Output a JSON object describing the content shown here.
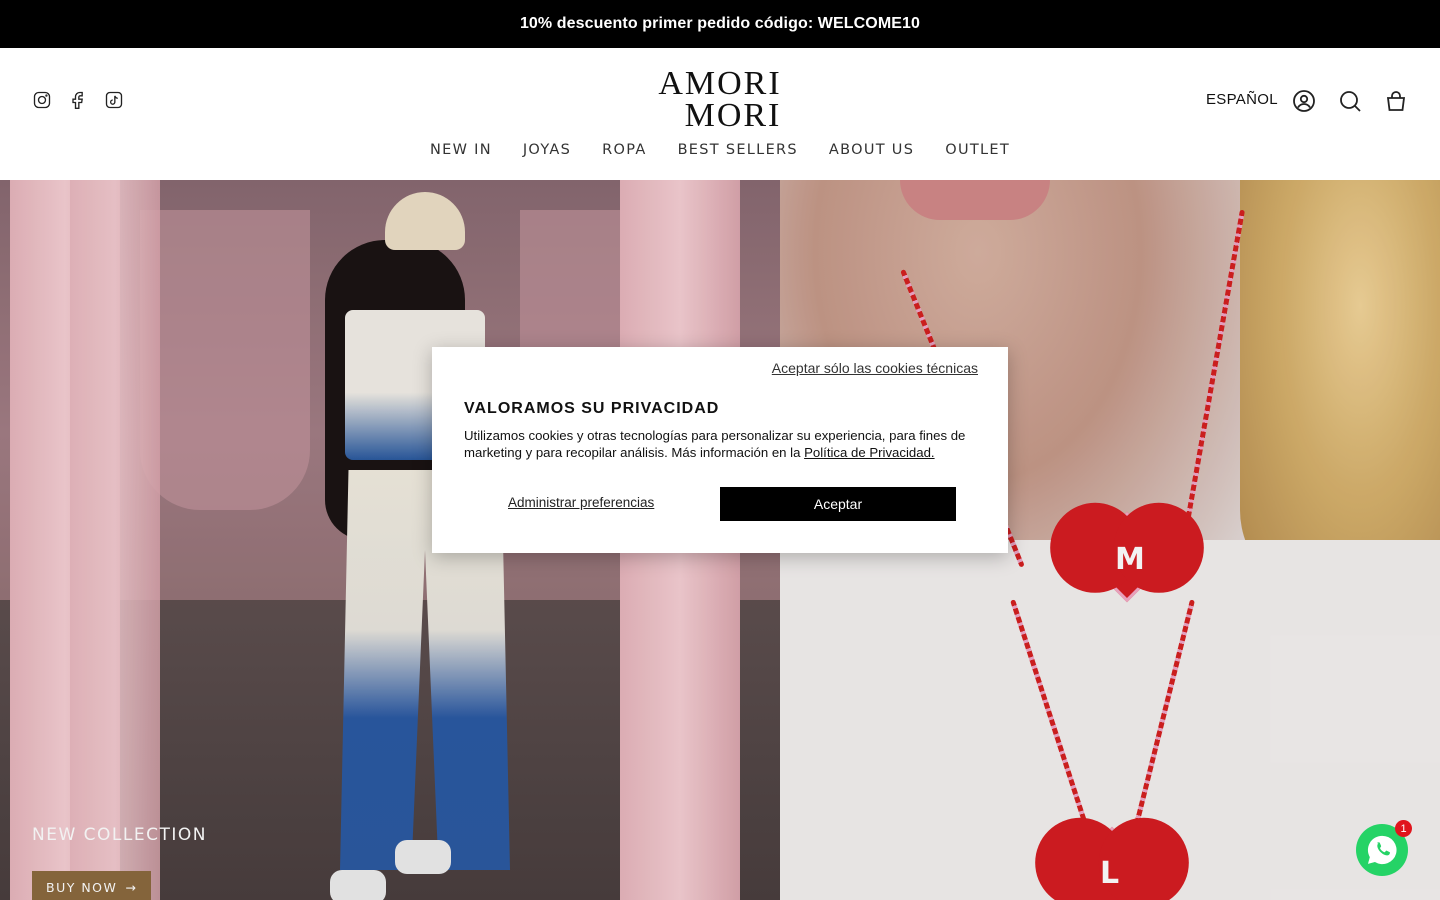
{
  "announcement": {
    "text": "10% descuento primer pedido código: WELCOME10"
  },
  "header": {
    "logo_line1": "AMORI",
    "logo_line2": "MORI",
    "language": "ESPAÑOL",
    "social_icons": [
      "instagram-icon",
      "facebook-icon",
      "tiktok-icon"
    ],
    "right_icons": [
      "account-icon",
      "search-icon",
      "cart-icon"
    ]
  },
  "nav": {
    "items": [
      "NEW IN",
      "JOYAS",
      "ROPA",
      "BEST SELLERS",
      "ABOUT US",
      "OUTLET"
    ]
  },
  "hero": {
    "collection_label": "NEW COLLECTION",
    "buy_label": "BUY NOW",
    "necklace_letters": [
      "M",
      "L"
    ]
  },
  "cookie_modal": {
    "technical_link": "Aceptar sólo las cookies técnicas",
    "title": "VALORAMOS SU PRIVACIDAD",
    "body_text": "Utilizamos cookies y otras tecnologías para personalizar su experiencia, para fines de marketing y para recopilar análisis. Más información en la ",
    "policy_link": "Política de Privacidad.",
    "preferences_label": "Administrar preferencias",
    "accept_label": "Aceptar"
  },
  "whatsapp": {
    "badge_count": "1"
  },
  "colors": {
    "announcement_bg": "#000000",
    "accept_bg": "#000000",
    "buy_bg": "#8c6a3f",
    "whatsapp": "#25d366"
  }
}
